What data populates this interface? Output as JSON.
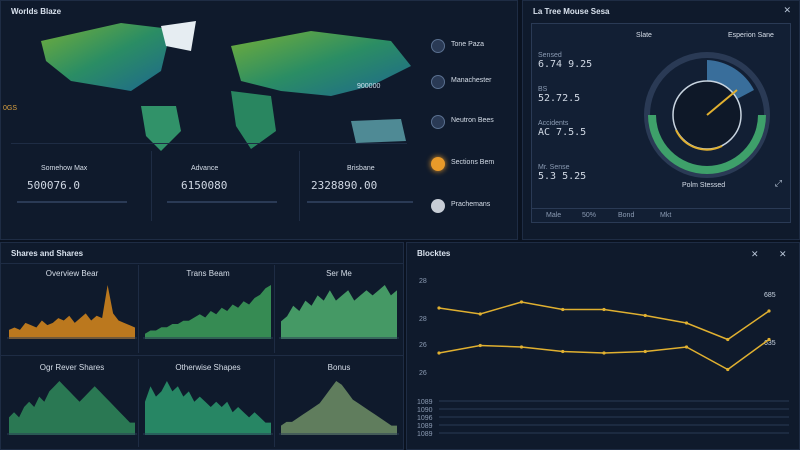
{
  "map_panel": {
    "title": "Worlds Blaze",
    "side_label": "0GS",
    "map_tag": "900000",
    "metrics": [
      {
        "title": "Somehow Max",
        "value": "500076.0"
      },
      {
        "title": "Advance",
        "value": "6150080"
      },
      {
        "title": "Brisbane",
        "value": "2328890.00"
      }
    ],
    "legend": [
      {
        "label": "Tone Paza"
      },
      {
        "label": "Manachester"
      },
      {
        "label": "Neutron Bees"
      },
      {
        "label": "Sections Bem"
      },
      {
        "label": "Prachemans"
      }
    ]
  },
  "gauge_panel": {
    "title": "La Tree Mouse Sesa",
    "stats": [
      {
        "label": "Sensed",
        "value": "6.74 9.25"
      },
      {
        "label": "BS",
        "value": "52.72.5"
      },
      {
        "label": "Accidents",
        "value": "AC 7.5.5"
      },
      {
        "label": "Mr. Sense",
        "value": "5.3 5.25"
      }
    ],
    "top_label": "Slate",
    "top_right_label": "Esperion Sane",
    "bottom_label": "Polm Stessed",
    "tabs": [
      "Male",
      "50%",
      "Bond",
      "Mkt"
    ]
  },
  "sparks_panel": {
    "title": "Shares and Shares",
    "cells": [
      {
        "title": "Overview Bear",
        "color": "#d98a1c"
      },
      {
        "title": "Trans Beam",
        "color": "#3da05a"
      },
      {
        "title": "Ser Me",
        "color": "#4fb070"
      },
      {
        "title": "Ogr Rever Shares",
        "color": "#2f8a5a"
      },
      {
        "title": "Otherwise Shapes",
        "color": "#2c9a6e"
      },
      {
        "title": "Bonus",
        "color": "#6f8f66"
      }
    ]
  },
  "line_panel": {
    "title": "Blocktes",
    "y_labels": [
      "28",
      "28",
      "26",
      "26"
    ],
    "right_labels": [
      "685",
      "635"
    ],
    "bottom_labels": [
      "1089",
      "1090",
      "1096",
      "1089",
      "1089"
    ]
  },
  "chart_data": {
    "type": "line",
    "title": "Blocktes",
    "x": [
      1,
      2,
      3,
      4,
      5,
      6,
      7,
      8,
      9
    ],
    "series": [
      {
        "values": [
          74,
          70,
          78,
          73,
          73,
          69,
          64,
          53,
          72
        ]
      },
      {
        "values": [
          44,
          49,
          48,
          45,
          44,
          45,
          48,
          33,
          53
        ]
      }
    ],
    "ylim": [
      20,
      100
    ],
    "grid": true
  },
  "colors": {
    "accent_orange": "#d98a1c",
    "accent_green": "#3da05a",
    "line_yellow": "#e0b030",
    "panel": "#0f1a2c"
  }
}
